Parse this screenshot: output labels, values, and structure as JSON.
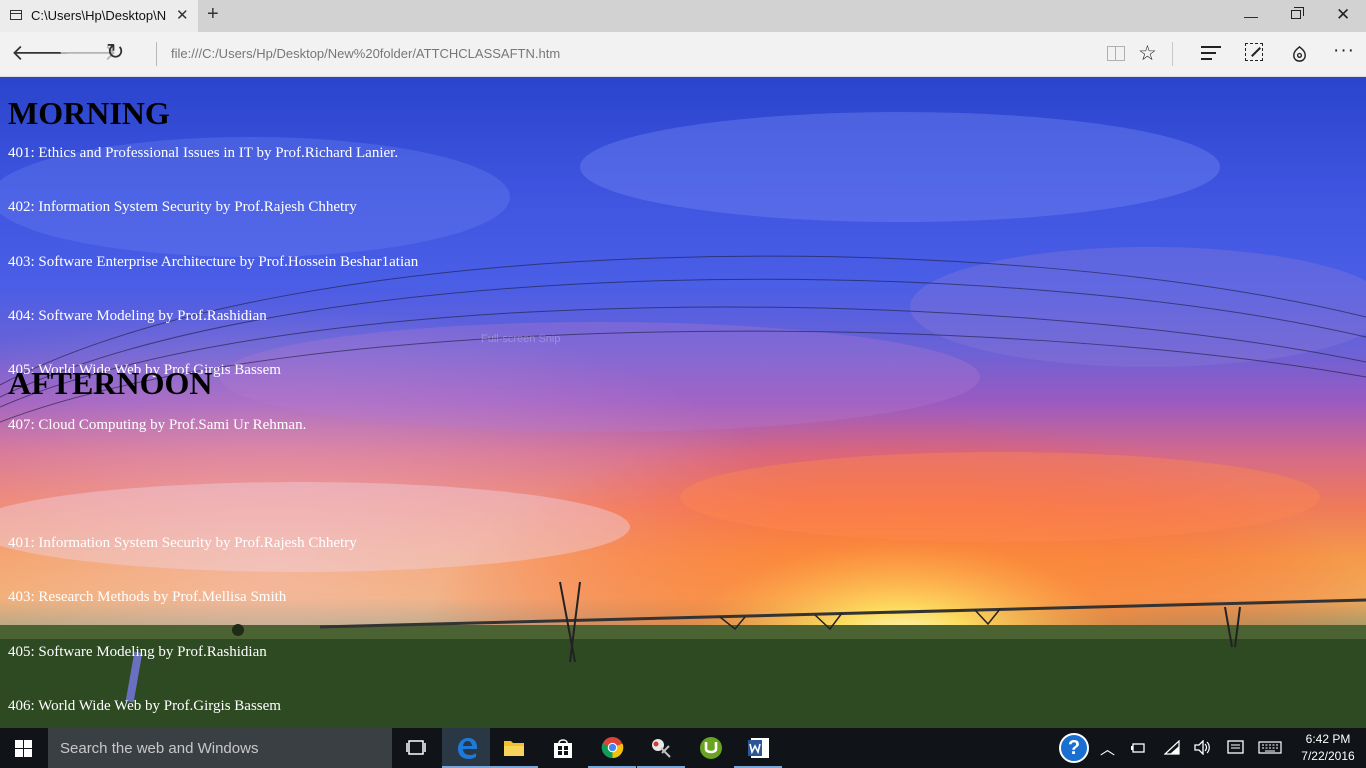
{
  "browser": {
    "tab_title": "C:\\Users\\Hp\\Desktop\\N",
    "tab_close": "✕",
    "new_tab": "+",
    "address": "file:///C:/Users/Hp/Desktop/New%20folder/ATTCHCLASSAFTN.htm",
    "buttons": {
      "back": "🡐",
      "forward": "🡒",
      "refresh": "↻",
      "favorite": "☆",
      "more": "···",
      "minimize": "—",
      "close": "✕"
    }
  },
  "page": {
    "morning_heading": "MORNING",
    "morning_courses": [
      "401: Ethics and Professional Issues in IT by Prof.Richard Lanier.",
      "402: Information System Security by Prof.Rajesh Chhetry",
      "403: Software Enterprise Architecture by Prof.Hossein Beshar1atian",
      "404: Software Modeling by Prof.Rashidian",
      "405: World Wide Web by Prof.Girgis Bassem",
      "407: Cloud Computing by Prof.Sami Ur Rehman."
    ],
    "afternoon_heading": "AFTERNOON",
    "afternoon_courses": [
      "401: Information System Security by Prof.Rajesh Chhetry",
      "403: Research Methods by Prof.Mellisa Smith",
      "405: Software Modeling by Prof.Rashidian",
      "406: World Wide Web by Prof.Girgis Bassem"
    ],
    "overlay_text": "Full-screen Snip"
  },
  "taskbar": {
    "search_placeholder": "Search the web and Windows",
    "help": "?",
    "time": "6:42 PM",
    "date": "7/22/2016",
    "icons": [
      "task-view-icon",
      "edge-icon",
      "file-explorer-icon",
      "store-icon",
      "chrome-icon",
      "snipping-tool-icon",
      "utorrent-icon",
      "word-icon"
    ]
  },
  "colors": {
    "edge_blue": "#1e7ad8",
    "word_blue": "#2b5797",
    "utorrent_green": "#6aa31f",
    "folder_yellow": "#f4c02b"
  }
}
